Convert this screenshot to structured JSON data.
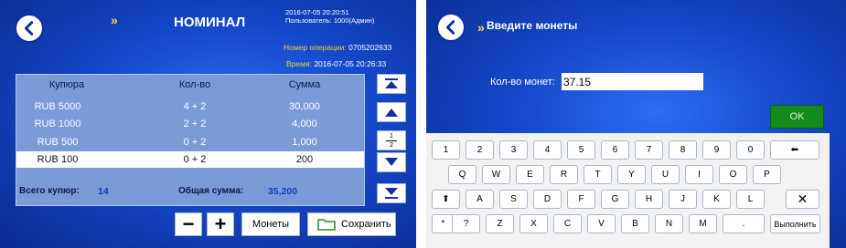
{
  "left": {
    "title": "НОМИНАЛ",
    "arrow_mark": "»",
    "datetime_top": "2016-07-05   20:20:51",
    "user_line": "Пользователь:   1000(Админ)",
    "op_label": "Номер операции:",
    "op_value": "0705202633",
    "time_label": "Время:",
    "time_value": "2016-07-05  20:26:33",
    "columns": [
      "Купюра",
      "Кол-во",
      "Сумма"
    ],
    "rows": [
      {
        "denom": "RUB 5000",
        "count": "4 + 2",
        "sum": "30,000",
        "selected": false
      },
      {
        "denom": "RUB 1000",
        "count": "2 + 2",
        "sum": "4,000",
        "selected": false
      },
      {
        "denom": "RUB 500",
        "count": "0 + 2",
        "sum": "1,000",
        "selected": false
      },
      {
        "denom": "RUB 100",
        "count": "0 + 2",
        "sum": "200",
        "selected": true
      }
    ],
    "total_notes_label": "Всего купюр:",
    "total_notes_value": "14",
    "total_sum_label": "Общая сумма:",
    "total_sum_value": "35,200",
    "page_current": "1",
    "page_total": "2",
    "minus_label": "−",
    "plus_label": "+",
    "coins_button": "Монеты",
    "save_button": "Сохранить"
  },
  "right": {
    "title": "Введите монеты",
    "arrow_mark": "»",
    "coins_label": "Кол-во монет:",
    "coins_value": "37.15",
    "ok_label": "OK",
    "keyboard": {
      "row1": [
        "1",
        "2",
        "3",
        "4",
        "5",
        "6",
        "7",
        "8",
        "9",
        "0",
        "⬅"
      ],
      "row2": [
        "Q",
        "W",
        "E",
        "R",
        "T",
        "Y",
        "U",
        "I",
        "O",
        "P"
      ],
      "row3": [
        "⬆",
        "A",
        "S",
        "D",
        "F",
        "G",
        "H",
        "J",
        "K",
        "L",
        "✕"
      ],
      "row4": [
        "*",
        "?",
        "Z",
        "X",
        "C",
        "V",
        "B",
        "N",
        "M",
        "."
      ],
      "done_label": "Выполнить"
    }
  },
  "colors": {
    "background": "#1547c9",
    "accent_yellow": "#f5d23b",
    "ok_green": "#148a1e"
  }
}
